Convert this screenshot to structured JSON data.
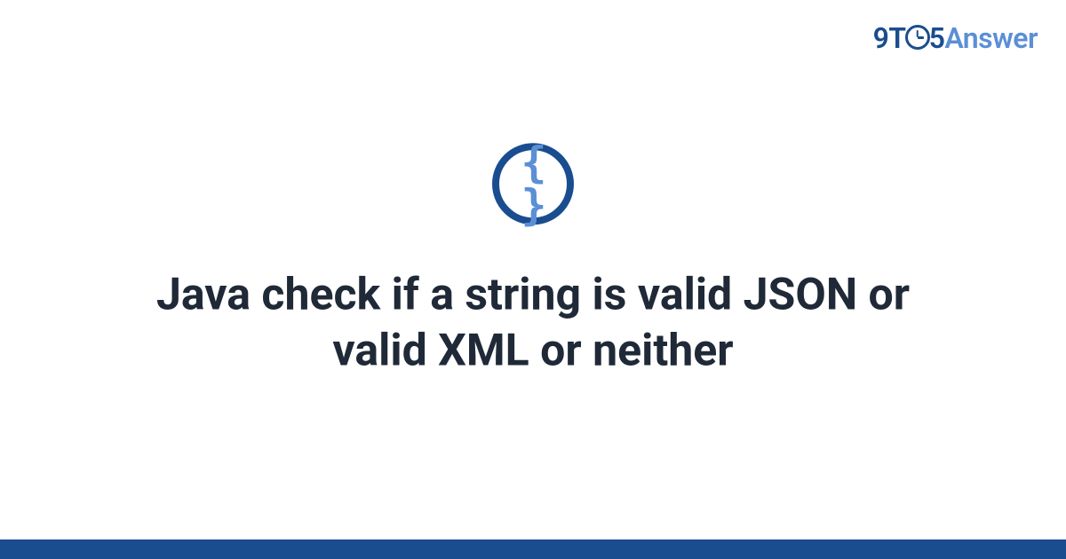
{
  "logo": {
    "part1": "9T",
    "part2": "5",
    "part3": "Answer"
  },
  "icon": {
    "braces": "{ }"
  },
  "title": "Java check if a string is valid JSON or valid XML or neither"
}
